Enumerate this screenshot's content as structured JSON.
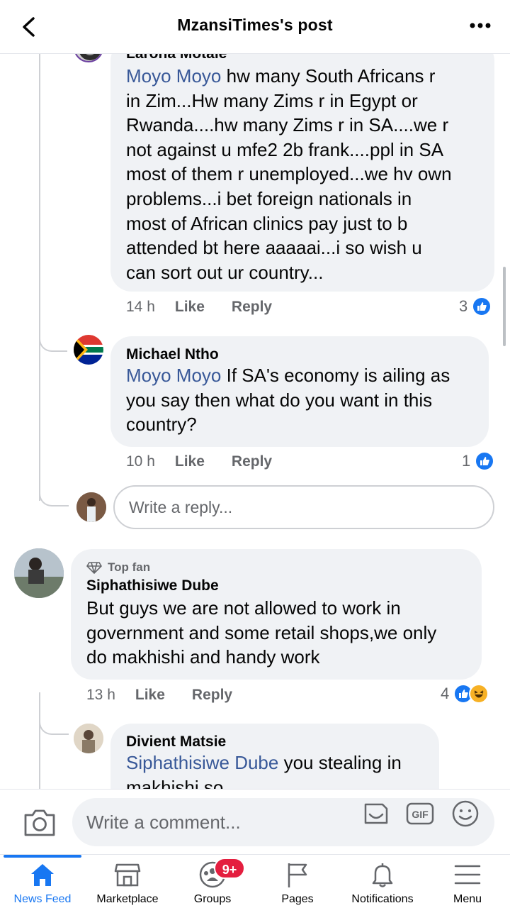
{
  "header": {
    "title": "MzansiTimes's post"
  },
  "comments": {
    "c1": {
      "author": "Larona Motale",
      "mention": "Moyo Moyo",
      "lines": [
        " hw many South Africans r",
        "in Zim...Hw many Zims r in Egypt or",
        "Rwanda....hw many Zims r in SA....we r",
        "not against u mfe2 2b frank....ppl in SA",
        "most of them r unemployed...we hv own",
        "problems...i bet foreign nationals in",
        "most of African clinics pay just to b",
        "attended bt here aaaaai...i so wish u",
        "can sort out ur country..."
      ],
      "time": "14 h",
      "like": "Like",
      "reply": "Reply",
      "reactions": "3"
    },
    "c2": {
      "author": "Michael Ntho",
      "mention": "Moyo Moyo",
      "lines": [
        " If SA's economy is ailing as",
        "you say then what do you want in this",
        "country?"
      ],
      "time": "10 h",
      "like": "Like",
      "reply": "Reply",
      "reactions": "1"
    },
    "reply_placeholder": "Write a reply...",
    "c3": {
      "badge": "Top fan",
      "author": "Siphathisiwe Dube",
      "lines": [
        "But guys we are not allowed to work in",
        "government and some retail shops,we only",
        "do makhishi and handy work"
      ],
      "time": "13 h",
      "like": "Like",
      "reply": "Reply",
      "reactions": "4"
    },
    "c4": {
      "author": "Divient Matsie",
      "mention": "Siphathisiwe Dube",
      "line1": " you stealing in",
      "line2": "makhishi so"
    }
  },
  "composer": {
    "placeholder": "Write a comment..."
  },
  "nav": {
    "items": [
      {
        "label": "News Feed",
        "icon": "home-icon",
        "active": true
      },
      {
        "label": "Marketplace",
        "icon": "marketplace-icon"
      },
      {
        "label": "Groups",
        "icon": "groups-icon",
        "badge": "9+"
      },
      {
        "label": "Pages",
        "icon": "flag-icon"
      },
      {
        "label": "Notifications",
        "icon": "bell-icon"
      },
      {
        "label": "Menu",
        "icon": "menu-icon"
      }
    ]
  },
  "colors": {
    "accent": "#1877f2",
    "mention": "#385898",
    "bubble": "#f0f2f5",
    "badge": "#e41e3f"
  }
}
